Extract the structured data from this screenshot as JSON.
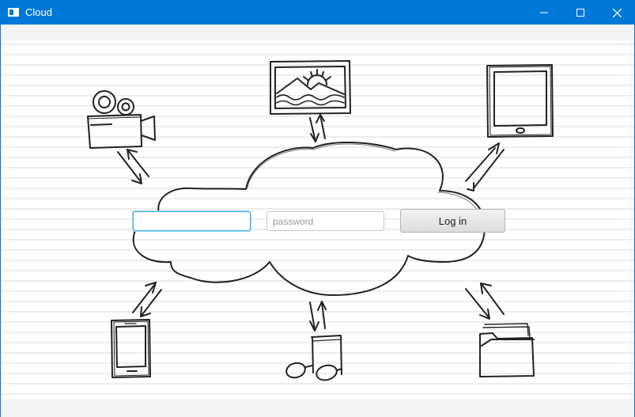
{
  "window": {
    "title": "Cloud",
    "controls": [
      "minimize",
      "maximize",
      "close"
    ]
  },
  "login": {
    "username_value": "",
    "password_placeholder": "password",
    "button_label": "Log in"
  },
  "illustrations": [
    "video-camera-icon",
    "picture-frame-icon",
    "tablet-icon",
    "phone-icon",
    "music-note-icon",
    "folder-icon",
    "cloud-icon"
  ],
  "colors": {
    "titlebar": "#0078d7",
    "focus_border": "#3daee9"
  }
}
